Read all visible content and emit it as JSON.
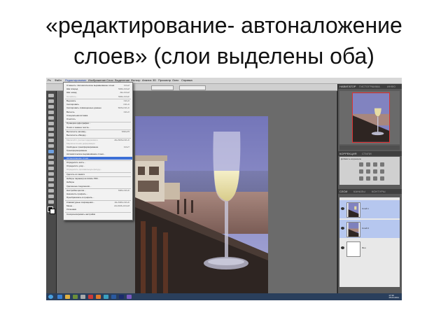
{
  "slide": {
    "title_line1": "«редактирование- автоналожение",
    "title_line2": "слоев» (слои выделены оба)"
  },
  "menubar": {
    "items": [
      "Ps",
      "Файл",
      "Редактирование",
      "Изображение",
      "Слои",
      "Выделение",
      "Фильтр",
      "Анализ",
      "3D",
      "Просмотр",
      "Окно",
      "Справка"
    ]
  },
  "options_bar": {
    "workspace": "ОСНОВНАЯ РАБОЧАЯ СРЕДА"
  },
  "edit_menu": {
    "items": [
      {
        "label": "Отменить: Автоматическое выравнивание слоев",
        "shortcut": "Ctrl+Z",
        "state": "normal"
      },
      {
        "label": "Шаг вперед",
        "shortcut": "Shift+Ctrl+Z",
        "state": "normal"
      },
      {
        "label": "Шаг назад",
        "shortcut": "Alt+Ctrl+Z",
        "state": "normal"
      },
      {
        "label": "Ослабить...",
        "shortcut": "Shift+Ctrl+F",
        "state": "dim"
      },
      {
        "label": "Вырезать",
        "shortcut": "Ctrl+X",
        "state": "normal"
      },
      {
        "label": "Скопировать",
        "shortcut": "Ctrl+C",
        "state": "normal"
      },
      {
        "label": "Скопировать совмещенные данные",
        "shortcut": "Shift+Ctrl+C",
        "state": "normal"
      },
      {
        "label": "Вклеить",
        "shortcut": "Ctrl+V",
        "state": "normal"
      },
      {
        "label": "Специальная вставка",
        "shortcut": "",
        "state": "normal"
      },
      {
        "label": "Очистить",
        "shortcut": "",
        "state": "normal"
      },
      {
        "label": "Проверка орфографии...",
        "shortcut": "",
        "state": "normal"
      },
      {
        "label": "Поиск и замена текста...",
        "shortcut": "",
        "state": "normal"
      },
      {
        "label": "Выполнить заливку...",
        "shortcut": "Shift+F5",
        "state": "normal"
      },
      {
        "label": "Выполнить обводку...",
        "shortcut": "",
        "state": "normal"
      },
      {
        "label": "Масштаб с учетом содержимого",
        "shortcut": "Alt+Shift+Ctrl+C",
        "state": "dim"
      },
      {
        "label": "Марионеточная деформация",
        "shortcut": "",
        "state": "dim"
      },
      {
        "label": "Свободное трансформирование",
        "shortcut": "Ctrl+T",
        "state": "normal"
      },
      {
        "label": "Трансформирование",
        "shortcut": "",
        "state": "normal"
      },
      {
        "label": "Автоматическое выравнивание слоев...",
        "shortcut": "",
        "state": "normal"
      },
      {
        "label": "Автоналожение слоев...",
        "shortcut": "",
        "state": "highlighted"
      },
      {
        "label": "Определить кисть...",
        "shortcut": "",
        "state": "normal"
      },
      {
        "label": "Определить узор...",
        "shortcut": "",
        "state": "normal"
      },
      {
        "label": "Определить произвольную фигуру...",
        "shortcut": "",
        "state": "dim"
      },
      {
        "label": "Удалить из памяти",
        "shortcut": "",
        "state": "normal"
      },
      {
        "label": "Наборы параметров Adobe PDF...",
        "shortcut": "",
        "state": "normal"
      },
      {
        "label": "Наборы",
        "shortcut": "",
        "state": "normal"
      },
      {
        "label": "Удаленные соединения...",
        "shortcut": "",
        "state": "normal"
      },
      {
        "label": "Настройка цветов...",
        "shortcut": "Shift+Ctrl+K",
        "state": "normal"
      },
      {
        "label": "Назначить профиль...",
        "shortcut": "",
        "state": "normal"
      },
      {
        "label": "Преобразовать в профиль...",
        "shortcut": "",
        "state": "normal"
      },
      {
        "label": "Клавиатурные сокращения...",
        "shortcut": "Alt+Shift+Ctrl+K",
        "state": "normal"
      },
      {
        "label": "Меню...",
        "shortcut": "Alt+Shift+Ctrl+M",
        "state": "normal"
      },
      {
        "label": "Установки",
        "shortcut": "",
        "state": "normal"
      },
      {
        "label": "Синхронизировать настройки",
        "shortcut": "",
        "state": "normal"
      }
    ]
  },
  "panels": {
    "navigator_tabs": [
      "НАВИГАТОР",
      "ГИСТОГРАММА",
      "ИНФО"
    ],
    "adjust_tabs": [
      "КОРРЕКЦИЯ",
      "СТИЛИ"
    ],
    "adjust_title": "Добавить коррекцию",
    "layers_tabs": [
      "СЛОИ",
      "КАНАЛЫ",
      "КОНТУРЫ"
    ],
    "layers": [
      {
        "name": "Слой 1",
        "selected": true
      },
      {
        "name": "Слой 0",
        "selected": true
      },
      {
        "name": "Фон",
        "selected": false
      }
    ]
  },
  "taskbar": {
    "time": "17:39",
    "date": "15.04.2011"
  },
  "colors": {
    "highlight": "#3d6fd6",
    "selected_layer": "#b6c7ef",
    "taskbar": "#2a3f5c"
  }
}
